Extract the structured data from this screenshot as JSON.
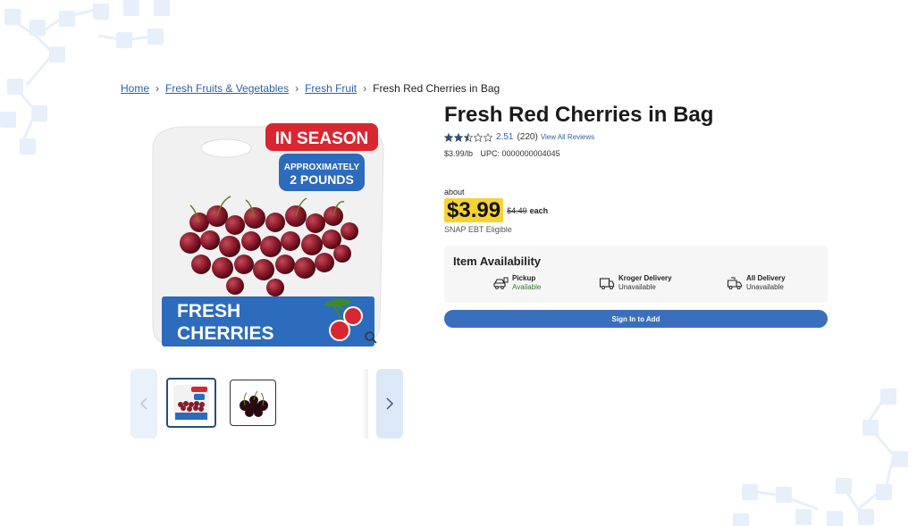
{
  "breadcrumb": {
    "items": [
      "Home",
      "Fresh Fruits & Vegetables",
      "Fresh Fruit"
    ],
    "current": "Fresh Red Cherries in Bag"
  },
  "product": {
    "title": "Fresh Red Cherries in Bag",
    "image_text": {
      "badge": "IN SEASON",
      "weight_line1": "APPROXIMATELY",
      "weight_line2": "2 POUNDS",
      "label_line1": "FRESH",
      "label_line2": "CHERRIES"
    },
    "rating": {
      "value": "2.51",
      "stars_fraction": 0.502,
      "count": "(220)",
      "view_all": "View All Reviews"
    },
    "unit_price": "$3.99/lb",
    "upc": "UPC: 0000000004045",
    "about": "about",
    "price": "$3.99",
    "old_price": "$4.49",
    "price_unit": "each",
    "snap": "SNAP EBT Eligible"
  },
  "availability": {
    "title": "Item Availability",
    "options": [
      {
        "label": "Pickup",
        "status": "Available",
        "icon": "pickup-car-icon"
      },
      {
        "label": "Kroger Delivery",
        "status": "Unavailable",
        "icon": "delivery-truck-icon"
      },
      {
        "label": "All Delivery",
        "status": "Unavailable",
        "icon": "delivery-van-icon"
      }
    ]
  },
  "cta": {
    "sign_in": "Sign In to Add"
  },
  "icons": [
    "chevron-right-icon",
    "star-icon",
    "magnify-icon",
    "chevron-left-icon"
  ],
  "colors": {
    "link": "#2e5fa8",
    "price_highlight": "#f7d332",
    "button": "#3a6fbd",
    "badge_red": "#d92630",
    "label_blue": "#2d6bbd"
  }
}
